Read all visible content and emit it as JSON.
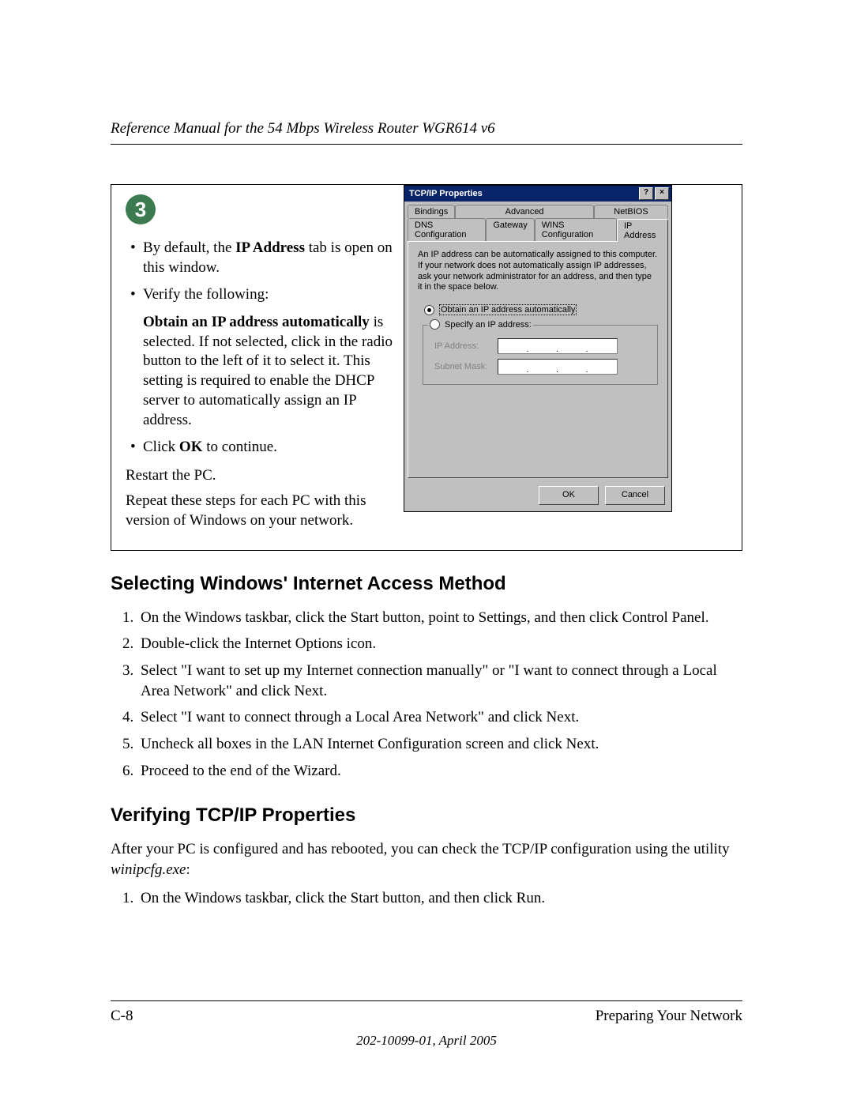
{
  "header": {
    "title": "Reference Manual for the 54 Mbps Wireless Router WGR614 v6"
  },
  "step": {
    "number": "3",
    "bullet1_pre": "By default, the ",
    "bullet1_bold": "IP Address",
    "bullet1_post": " tab is open on this window.",
    "bullet2": "Verify the following:",
    "sub_bold": "Obtain an IP address automatically",
    "sub_rest": " is selected. If not selected, click in the radio button to the left of it to select it.  This setting is required to enable the DHCP server to automatically assign an IP address.",
    "bullet3_pre": "Click ",
    "bullet3_bold": "OK",
    "bullet3_post": " to continue.",
    "restart": "Restart the PC.",
    "repeat": "Repeat these steps for each PC with this version of Windows on your network."
  },
  "dialog": {
    "title": "TCP/IP Properties",
    "tabs_row1": [
      "Bindings",
      "Advanced",
      "NetBIOS"
    ],
    "tabs_row2": [
      "DNS Configuration",
      "Gateway",
      "WINS Configuration",
      "IP Address"
    ],
    "desc": "An IP address can be automatically assigned to this computer. If your network does not automatically assign IP addresses, ask your network administrator for an address, and then type it in the space below.",
    "radio_auto": "Obtain an IP address automatically",
    "radio_specify": "Specify an IP address:",
    "ip_label": "IP Address:",
    "mask_label": "Subnet Mask:",
    "ok": "OK",
    "cancel": "Cancel"
  },
  "section1": {
    "heading": "Selecting Windows' Internet Access Method",
    "items": [
      "On the Windows taskbar, click the Start button, point to Settings, and then click Control Panel.",
      "Double-click the Internet Options icon.",
      "Select \"I want to set up my Internet connection manually\" or \"I want to connect through a Local Area Network\" and click Next.",
      "Select \"I want to connect through a Local Area Network\" and click Next.",
      "Uncheck all boxes in the LAN Internet Configuration screen and click Next.",
      "Proceed to the end of the Wizard."
    ]
  },
  "section2": {
    "heading": "Verifying TCP/IP Properties",
    "intro_pre": "After your PC is configured and has rebooted, you can check the TCP/IP configuration using the utility ",
    "intro_ital": "winipcfg.exe",
    "intro_post": ":",
    "items": [
      "On the Windows taskbar, click the Start button, and then click Run."
    ]
  },
  "footer": {
    "left": "C-8",
    "right": "Preparing Your Network",
    "center": "202-10099-01, April 2005"
  }
}
